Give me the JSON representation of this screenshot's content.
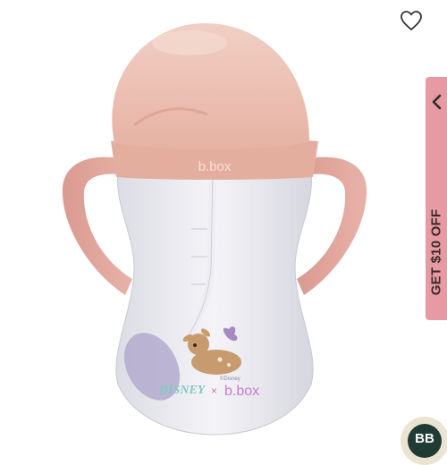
{
  "product": {
    "image_label": "b.box",
    "cup_brand": "b.box",
    "collab_left": "DISNEY",
    "collab_x": "×",
    "collab_right": "b.box",
    "copyright": "©Disney",
    "accent_color": "#e9b7a9"
  },
  "wishlist": {
    "icon": "heart-outline-icon"
  },
  "promo": {
    "label": "GET $10 OFF",
    "icon": "chevron-left-icon",
    "color": "#e79aa3"
  },
  "chat": {
    "initials": "BB",
    "color": "#1f3b34"
  }
}
